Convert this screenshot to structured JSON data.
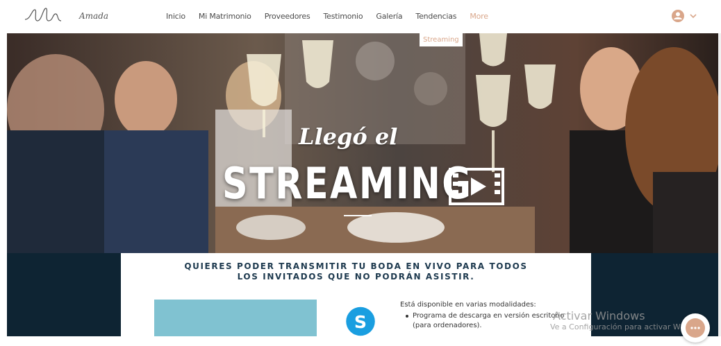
{
  "header": {
    "brand": "Amada",
    "nav": [
      {
        "label": "Inicio"
      },
      {
        "label": "Mi Matrimonio"
      },
      {
        "label": "Proveedores"
      },
      {
        "label": "Testimonio"
      },
      {
        "label": "Galería"
      },
      {
        "label": "Tendencias"
      },
      {
        "label": "More"
      }
    ],
    "dropdown_item": "Streaming",
    "icons": {
      "logo": "ele-script-logo",
      "user": "user-avatar-icon",
      "chevron": "chevron-down-icon"
    },
    "accent_color": "#d9a68a"
  },
  "hero": {
    "script_title": "Llegó el",
    "big_title": "STREAMING",
    "icon": "film-play-icon"
  },
  "section": {
    "headline_line1": "QUIERES PODER TRANSMITIR TU BODA EN VIVO PARA TODOS",
    "headline_line2": "LOS INVITADOS QUE NO PODRÁN ASISTIR.",
    "available_text": "Está disponible en varias modalidades:",
    "bullets": [
      "Programa de descarga en versión escritorio (para ordenadores)."
    ],
    "icon": "skype-icon",
    "bg_color": "#0e2433",
    "headline_color": "#1e3a4f"
  },
  "watermark": {
    "title": "Activar Windows",
    "subtitle": "Ve a Configuración para activar Windows."
  },
  "chat": {
    "icon": "chat-bubble-icon"
  }
}
